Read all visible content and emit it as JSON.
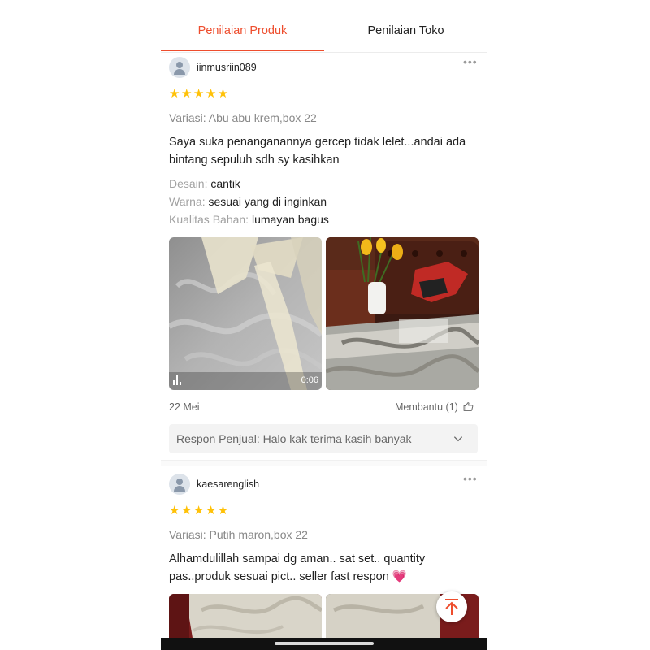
{
  "tabs": {
    "product_reviews": "Penilaian Produk",
    "shop_reviews": "Penilaian Toko"
  },
  "reviews": [
    {
      "username": "iinmusriin089",
      "rating": 5,
      "stars": "★★★★★",
      "variant": "Variasi: Abu abu krem,box 22",
      "comment": "Saya suka penanganannya gercep tidak lelet...andai ada bintang sepuluh sdh sy kasihkan",
      "attributes": [
        {
          "label": "Desain:",
          "value": "cantik"
        },
        {
          "label": "Warna:",
          "value": "sesuai yang di inginkan"
        },
        {
          "label": "Kualitas Bahan:",
          "value": "lumayan bagus"
        }
      ],
      "video_duration": "0:06",
      "date": "22 Mei",
      "helpful": "Membantu (1)",
      "seller_response": "Respon Penjual: Halo kak terima kasih banyak"
    },
    {
      "username": "kaesarenglish",
      "rating": 5,
      "stars": "★★★★★",
      "variant": "Variasi: Putih maron,box 22",
      "comment": "Alhamdulillah sampai dg aman.. sat set.. quantity pas..produk sesuai pict.. seller fast respon",
      "comment_emoji": "💗"
    }
  ],
  "colors": {
    "accent": "#ee4d2d",
    "star": "#ffc107",
    "muted_text": "#888888"
  },
  "icons": {
    "avatar": "user-avatar-icon",
    "more": "more-dots-icon",
    "video": "video-bars-icon",
    "thumbs_up": "thumbs-up-icon",
    "expand": "chevron-down-icon",
    "scroll_top": "arrow-up-icon"
  }
}
